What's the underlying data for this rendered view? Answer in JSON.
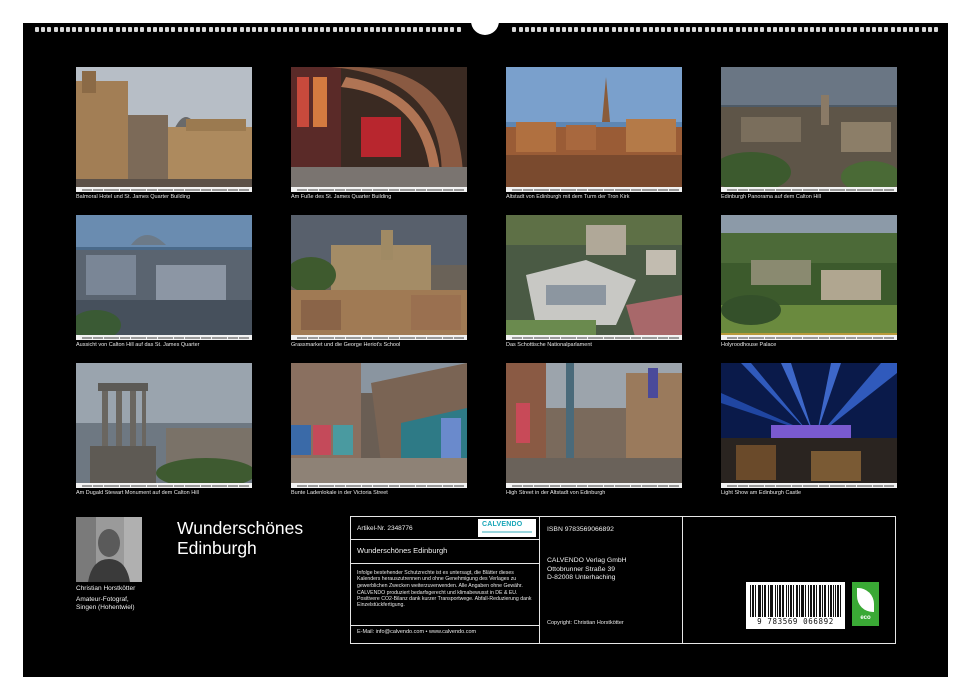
{
  "photos": [
    {
      "caption": "Balmoral Hotel und St. James Quarter Building"
    },
    {
      "caption": "Am Fuße des St. James Quarter Building"
    },
    {
      "caption": "Altstadt von Edinburgh mit dem Turm der Tron Kirk"
    },
    {
      "caption": "Edinburgh Panorama auf dem Calton Hill"
    },
    {
      "caption": "Aussicht von Calton Hill auf das St. James Quarter"
    },
    {
      "caption": "Grassmarket und die George Heriot's School"
    },
    {
      "caption": "Das Schottische Nationalparlament"
    },
    {
      "caption": "Holyroodhouse Palace"
    },
    {
      "caption": "Am Dugald Stewart Monument auf dem Calton Hill"
    },
    {
      "caption": "Bunte Ladenlokale in der Victoria Street"
    },
    {
      "caption": "High Street in der Altstadt von Edinburgh"
    },
    {
      "caption": "Light Show am Edinburgh Castle"
    }
  ],
  "author": {
    "name": "Christian Horstkötter",
    "role_line1": "Amateur-Fotograf,",
    "role_line2": "Singen (Hohentwiel)"
  },
  "calendar_title": {
    "line1": "Wunderschönes",
    "line2": "Edinburgh"
  },
  "info": {
    "article_no": "Artikel-Nr. 2348776",
    "brand_logo": "CALVENDO",
    "product_name": "Wunderschönes Edinburgh",
    "legal_1": "Infolge bestehender Schutzrechte ist es untersagt, die Blätter dieses Kalenders herauszutrennen und ohne Genehmigung des Verlages zu gewerblichen Zwecken weiterzuverwenden. Alle Angaben ohne Gewähr.",
    "legal_2": "CALVENDO produziert bedarfsgerecht und klimabewusst in DE & EU. Positivere CO2-Bilanz dank kurzer Transportwege. Abfall-Reduzierung dank Einzelstückfertigung.",
    "contact": "E-Mail: info@calvendo.com • www.calvendo.com",
    "isbn": "ISBN 9783569066892",
    "publisher_line1": "CALVENDO Verlag GmbH",
    "publisher_line2": "Ottobrunner Straße 39",
    "publisher_line3": "D-82008 Unterhaching",
    "copyright": "Copyright: Christian Horstkötter",
    "barcode_number": "9 783569 066892",
    "eco_label": "eco"
  }
}
